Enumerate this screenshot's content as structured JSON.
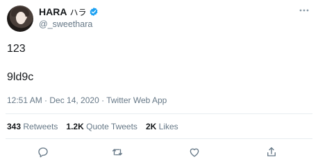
{
  "author": {
    "display_name": "HARA",
    "display_name_suffix": "ハラ",
    "handle": "@_sweethara",
    "verified": true
  },
  "tweet": {
    "lines": [
      "123",
      "9ld9c"
    ],
    "timestamp": "12:51 AM · Dec 14, 2020 · Twitter Web App"
  },
  "stats": {
    "retweets_count": "343",
    "retweets_label": "Retweets",
    "quote_count": "1.2K",
    "quote_label": "Quote Tweets",
    "likes_count": "2K",
    "likes_label": "Likes"
  },
  "icons": {
    "more": "more-icon",
    "reply": "reply-icon",
    "retweet": "retweet-icon",
    "like": "like-icon",
    "share": "share-icon",
    "verified": "verified-icon"
  },
  "colors": {
    "verified": "#1da1f2",
    "secondary_text": "#657786",
    "primary_text": "#14171a"
  }
}
